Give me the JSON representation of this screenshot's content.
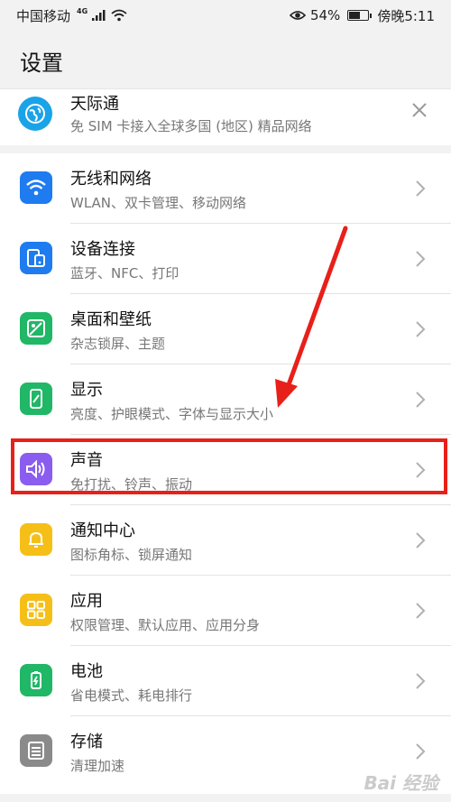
{
  "status_bar": {
    "carrier": "中国移动",
    "network": "4G",
    "battery_percent": "54%",
    "time": "傍晚5:11",
    "battery_level": 0.54
  },
  "page": {
    "title": "设置"
  },
  "banner": {
    "title": "天际通",
    "subtitle": "免 SIM 卡接入全球多国 (地区) 精品网络",
    "icon": "globe-icon"
  },
  "items": [
    {
      "title": "无线和网络",
      "subtitle": "WLAN、双卡管理、移动网络",
      "icon": "wifi-icon",
      "color": "#1f7bf0"
    },
    {
      "title": "设备连接",
      "subtitle": "蓝牙、NFC、打印",
      "icon": "device-connect-icon",
      "color": "#1f7bf0"
    },
    {
      "title": "桌面和壁纸",
      "subtitle": "杂志锁屏、主题",
      "icon": "wallpaper-icon",
      "color": "#20b766"
    },
    {
      "title": "显示",
      "subtitle": "亮度、护眼模式、字体与显示大小",
      "icon": "display-icon",
      "color": "#20b766"
    },
    {
      "title": "声音",
      "subtitle": "免打扰、铃声、振动",
      "icon": "sound-icon",
      "color": "#8a5cf0"
    },
    {
      "title": "通知中心",
      "subtitle": "图标角标、锁屏通知",
      "icon": "bell-icon",
      "color": "#f5bf18"
    },
    {
      "title": "应用",
      "subtitle": "权限管理、默认应用、应用分身",
      "icon": "apps-icon",
      "color": "#f5bf18"
    },
    {
      "title": "电池",
      "subtitle": "省电模式、耗电排行",
      "icon": "battery-icon",
      "color": "#20b766"
    },
    {
      "title": "存储",
      "subtitle": "清理加速",
      "icon": "storage-icon",
      "color": "#8a8a8a"
    }
  ],
  "watermark": "Bai 经验"
}
